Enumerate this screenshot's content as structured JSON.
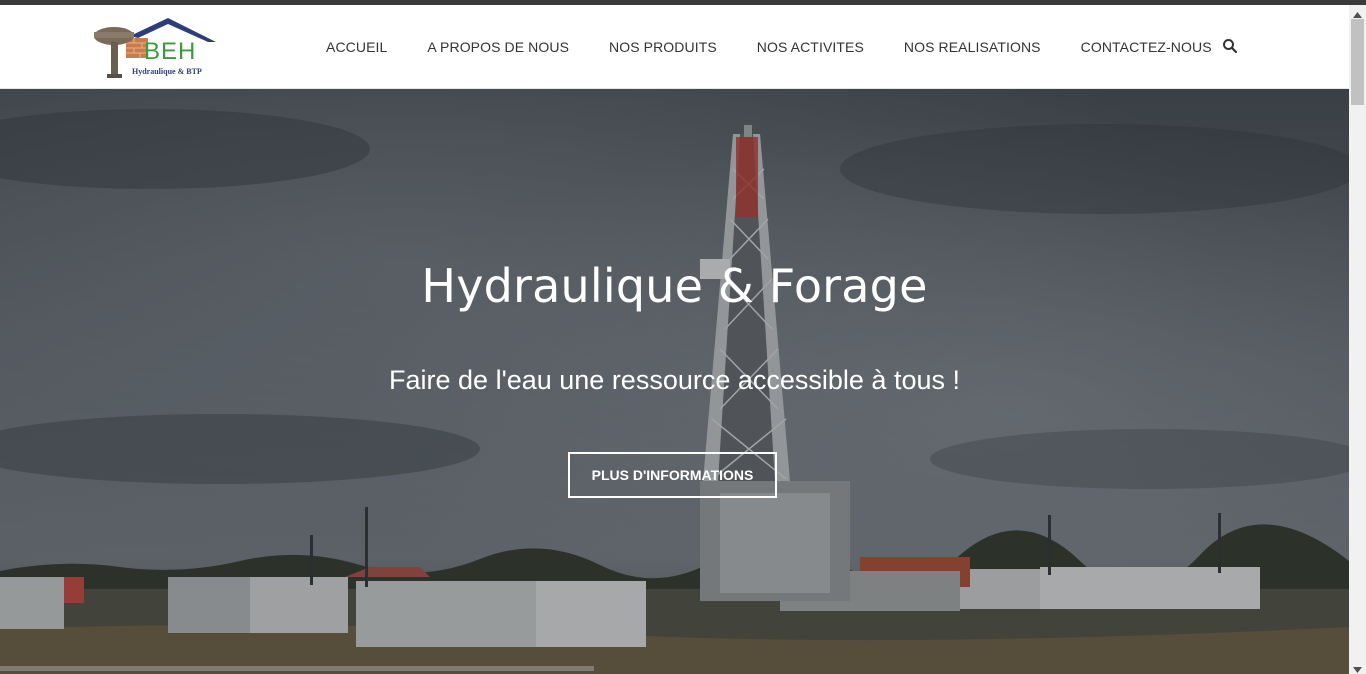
{
  "header": {
    "logo": {
      "title": "BEH",
      "subtitle": "Hydraulique & BTP"
    },
    "nav": {
      "items": [
        {
          "label": "ACCUEIL"
        },
        {
          "label": "A PROPOS DE NOUS"
        },
        {
          "label": "NOS PRODUITS"
        },
        {
          "label": "NOS ACTIVITES"
        },
        {
          "label": "NOS REALISATIONS"
        },
        {
          "label": "CONTACTEZ-NOUS"
        }
      ],
      "search_icon": "search-icon"
    }
  },
  "hero": {
    "title": "Hydraulique & Forage",
    "subtitle": "Faire de l'eau une ressource accessible à tous !",
    "button_label": "PLUS D'INFORMATIONS"
  },
  "colors": {
    "logo_green": "#3c9a3c",
    "logo_blue": "#2e3d7a",
    "nav_text": "#333333",
    "hero_overlay": "#4a5158"
  }
}
